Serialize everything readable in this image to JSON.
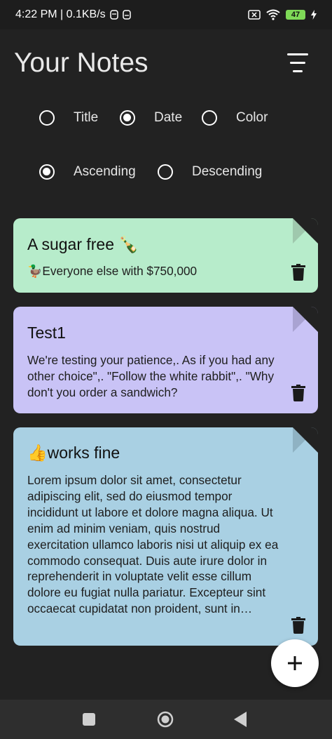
{
  "status_bar": {
    "time_speed": "4:22 PM | 0.1KB/s",
    "battery": "47"
  },
  "header": {
    "title": "Your Notes",
    "sort_icon": "sort-menu-icon"
  },
  "sort_options": {
    "order_by": [
      {
        "label": "Title",
        "selected": false
      },
      {
        "label": "Date",
        "selected": true
      },
      {
        "label": "Color",
        "selected": false
      }
    ],
    "direction": [
      {
        "label": "Ascending",
        "selected": true
      },
      {
        "label": "Descending",
        "selected": false
      }
    ]
  },
  "notes": [
    {
      "title": "A sugar free 🍾",
      "content": "🦆Everyone else with $750,000",
      "color": "#b7eccb",
      "fold_color": "#9fc8ad"
    },
    {
      "title": "Test1",
      "content": "We're testing your patience,. As if you had any other choice\",. \"Follow the white rabbit\",. \"Why don't you order a sandwich?",
      "color": "#c9c3f6",
      "fold_color": "#a9a3d2"
    },
    {
      "title": "👍works fine",
      "content": "Lorem ipsum dolor sit amet, consectetur adipiscing elit, sed do eiusmod tempor incididunt ut labore et dolore magna aliqua. Ut enim ad minim veniam, quis nostrud exercitation ullamco laboris nisi ut aliquip ex ea commodo consequat. Duis aute irure dolor in reprehenderit in voluptate velit esse cillum dolore eu fugiat nulla pariatur. Excepteur sint occaecat cupidatat non proident, sunt in…",
      "color": "#a9d0e3",
      "fold_color": "#8fb2c3"
    }
  ],
  "fab": {
    "icon": "plus-icon"
  },
  "nav": {
    "icons": [
      "recents-square-icon",
      "home-circle-icon",
      "back-triangle-icon"
    ]
  }
}
